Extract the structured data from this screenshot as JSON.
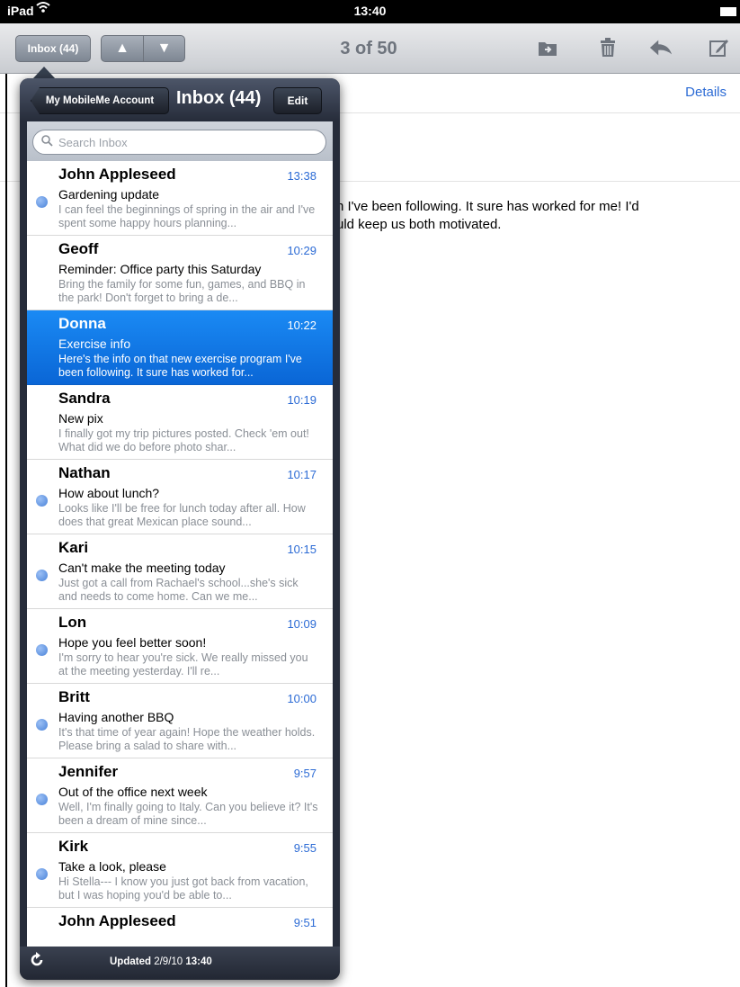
{
  "status_bar": {
    "carrier": "iPad",
    "time": "13:40"
  },
  "toolbar": {
    "inbox_button_label": "Inbox (44)",
    "up_arrow": "▲",
    "down_arrow": "▼",
    "counter": "3 of 50",
    "icons": [
      "folder-move-icon",
      "trash-icon",
      "reply-icon",
      "compose-icon"
    ]
  },
  "detail": {
    "details_link": "Details",
    "body_line_1": "n I've been following. It sure has worked for me! I'd",
    "body_line_2": "uld keep us both motivated."
  },
  "popover": {
    "back_button": "My MobileMe Account",
    "title": "Inbox (44)",
    "edit_button": "Edit",
    "search_placeholder": "Search Inbox",
    "messages": [
      {
        "sender": "John Appleseed",
        "time": "13:38",
        "subject": "Gardening update",
        "preview": "I can feel the beginnings of spring in the air and I've spent some happy hours planning...",
        "unread": true
      },
      {
        "sender": "Geoff",
        "time": "10:29",
        "subject": "Reminder: Office party this Saturday",
        "preview": "Bring the family for some fun, games, and BBQ in the park! Don't forget to bring a de...",
        "unread": false
      },
      {
        "sender": "Donna",
        "time": "10:22",
        "subject": "Exercise info",
        "preview": "Here's the info on that new exercise program I've been following. It sure has worked for...",
        "unread": false,
        "selected": true
      },
      {
        "sender": "Sandra",
        "time": "10:19",
        "subject": "New pix",
        "preview": "I finally got my trip pictures posted. Check 'em out! What did we do before photo shar...",
        "unread": false
      },
      {
        "sender": "Nathan",
        "time": "10:17",
        "subject": "How about lunch?",
        "preview": "Looks like I'll be free for lunch today after all. How does that great Mexican place sound...",
        "unread": true
      },
      {
        "sender": "Kari",
        "time": "10:15",
        "subject": "Can't make the meeting today",
        "preview": "Just got a call from Rachael's school...she's sick and needs to come home. Can we me...",
        "unread": true
      },
      {
        "sender": "Lon",
        "time": "10:09",
        "subject": "Hope you feel better soon!",
        "preview": "I'm sorry to hear you're sick. We really missed you at the meeting yesterday. I'll re...",
        "unread": true
      },
      {
        "sender": "Britt",
        "time": "10:00",
        "subject": "Having another BBQ",
        "preview": "It's that time of year again! Hope the weather holds. Please bring a salad to share with...",
        "unread": true
      },
      {
        "sender": "Jennifer",
        "time": "9:57",
        "subject": "Out of the office next week",
        "preview": "Well, I'm finally going to Italy. Can you believe it? It's been a dream of mine since...",
        "unread": true
      },
      {
        "sender": "Kirk",
        "time": "9:55",
        "subject": "Take a look, please",
        "preview": "Hi Stella--- I know you just got back from vacation, but I was hoping you'd be able to...",
        "unread": true
      },
      {
        "sender": "John Appleseed",
        "time": "9:51",
        "subject": "",
        "preview": "",
        "unread": false
      }
    ],
    "footer": {
      "label": "Updated",
      "date": "2/9/10",
      "time": "13:40"
    }
  }
}
